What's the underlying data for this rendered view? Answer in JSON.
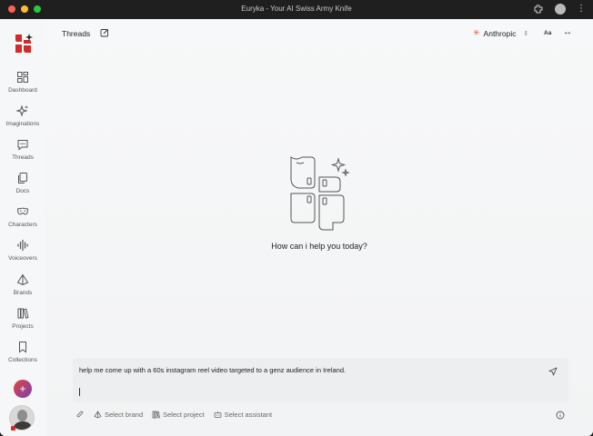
{
  "window": {
    "title": "Euryka - Your AI Swiss Army Knife"
  },
  "sidebar": {
    "items": [
      {
        "label": "Dashboard",
        "icon": "dashboard-icon"
      },
      {
        "label": "Imaginations",
        "icon": "sparkles-icon"
      },
      {
        "label": "Threads",
        "icon": "chat-icon"
      },
      {
        "label": "Docs",
        "icon": "docs-icon"
      },
      {
        "label": "Characters",
        "icon": "mask-icon"
      },
      {
        "label": "Voiceovers",
        "icon": "waveform-icon"
      },
      {
        "label": "Brands",
        "icon": "pyramid-icon"
      },
      {
        "label": "Projects",
        "icon": "books-icon"
      },
      {
        "label": "Collections",
        "icon": "bookmark-icon"
      }
    ],
    "plus_label": "+"
  },
  "header": {
    "title": "Threads",
    "provider": "Anthropic",
    "font_toggle": "Aa",
    "expand": "↔"
  },
  "main": {
    "welcome": "How can i help you today?"
  },
  "composer": {
    "value": "help me come up with a 60s instagram reel video targeted to a genz audience in Ireland."
  },
  "toolbar": {
    "select_brand": "Select brand",
    "select_project": "Select project",
    "select_assistant": "Select assistant"
  },
  "colors": {
    "accent_red": "#d12b2b",
    "background": "#f6f7f8",
    "titlebar": "#1f1f1f"
  }
}
